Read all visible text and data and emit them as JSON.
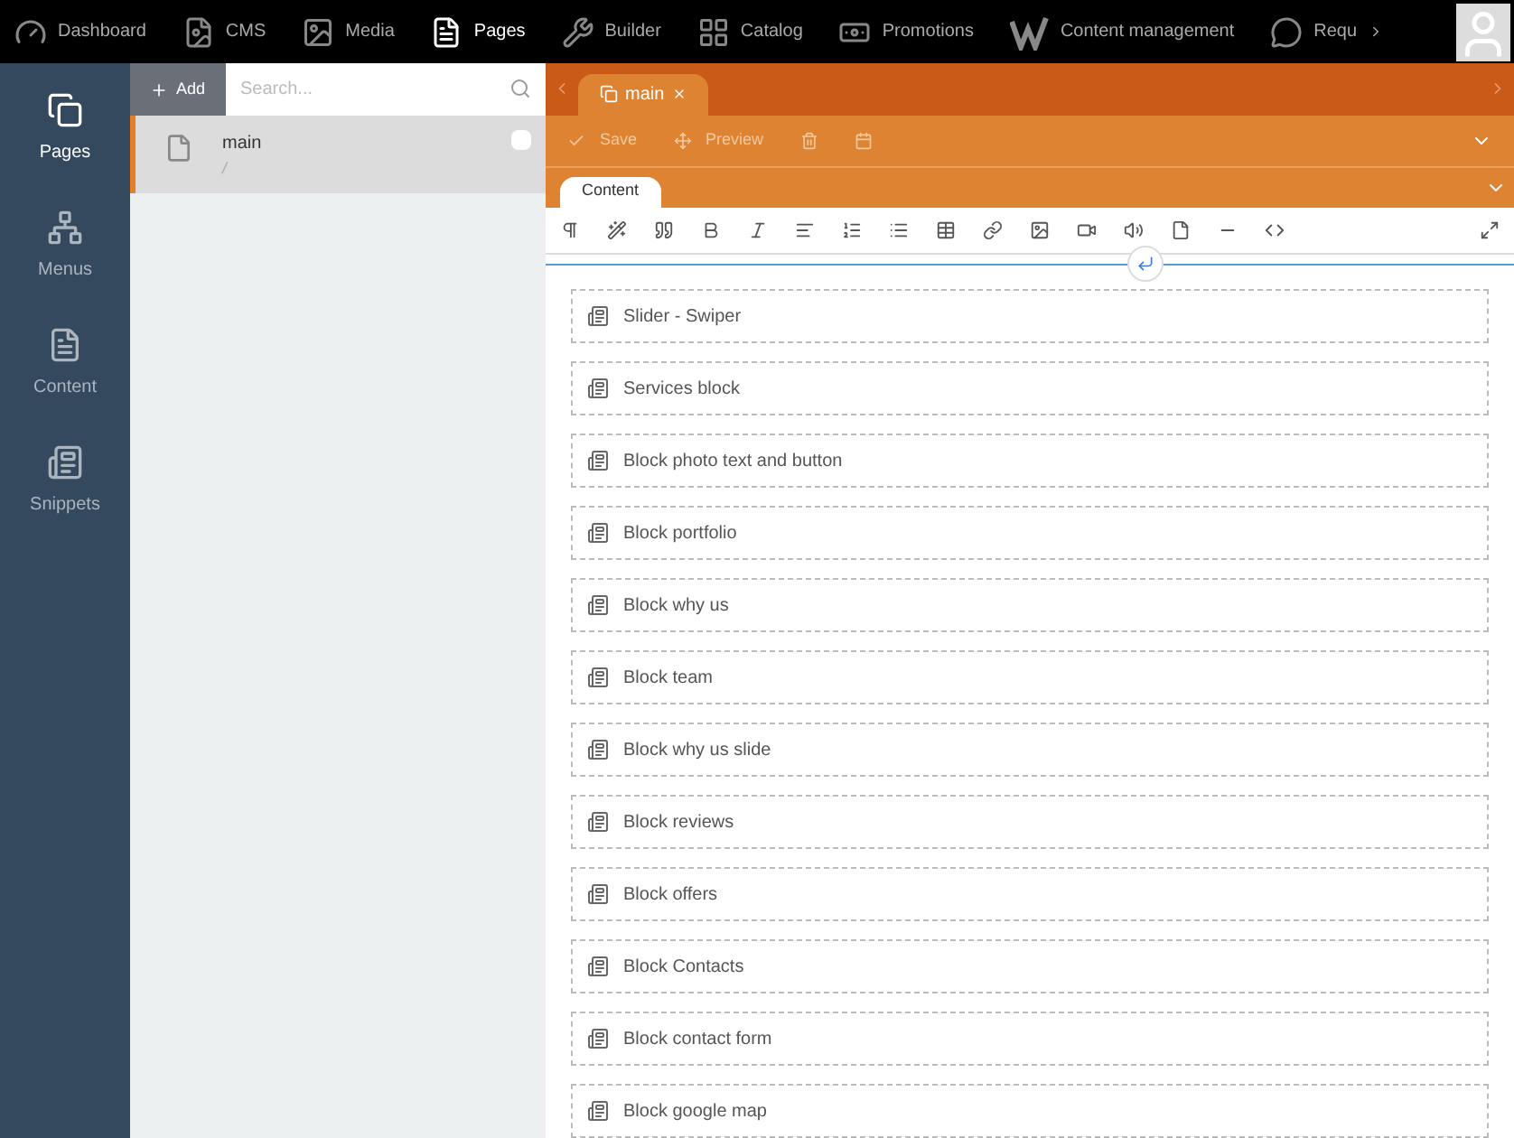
{
  "top_nav": [
    {
      "label": "Dashboard",
      "selected": false
    },
    {
      "label": "CMS",
      "selected": false
    },
    {
      "label": "Media",
      "selected": false
    },
    {
      "label": "Pages",
      "selected": true
    },
    {
      "label": "Builder",
      "selected": false
    },
    {
      "label": "Catalog",
      "selected": false
    },
    {
      "label": "Promotions",
      "selected": false
    },
    {
      "label": "Content management",
      "selected": false
    },
    {
      "label": "Requ",
      "selected": false
    }
  ],
  "sidebar": {
    "items": [
      {
        "label": "Pages",
        "selected": true
      },
      {
        "label": "Menus",
        "selected": false
      },
      {
        "label": "Content",
        "selected": false
      },
      {
        "label": "Snippets",
        "selected": false
      }
    ]
  },
  "page_list": {
    "add_button": "Add",
    "search": {
      "placeholder": "Search..."
    },
    "items": [
      {
        "title": "main",
        "path": "/",
        "selected": true,
        "checked": false
      }
    ]
  },
  "editor": {
    "tabs": [
      {
        "label": "main",
        "selected": true
      }
    ],
    "actions": [
      {
        "label": "Save"
      },
      {
        "label": "Preview"
      }
    ],
    "content_tabs": [
      {
        "label": "Content",
        "selected": true
      }
    ],
    "blocks": [
      "Slider - Swiper",
      "Services block",
      "Block photo text and button",
      "Block portfolio",
      "Block why us",
      "Block team",
      "Block why us slide",
      "Block reviews",
      "Block offers",
      "Block Contacts",
      "Block contact form",
      "Block google map"
    ]
  }
}
